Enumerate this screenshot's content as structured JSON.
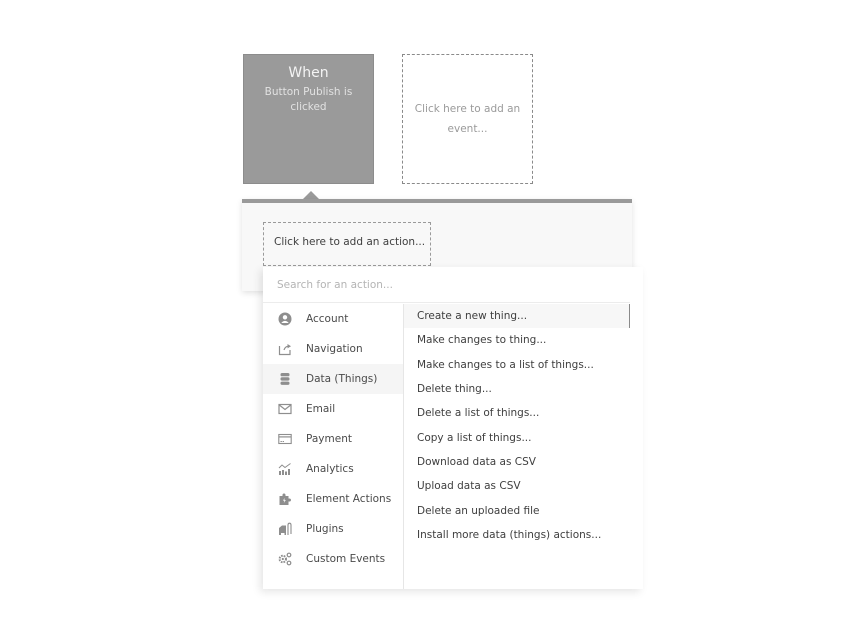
{
  "event": {
    "title": "When",
    "description": "Button Publish is clicked",
    "add_event_label": "Click here to add an event..."
  },
  "action_panel": {
    "add_action_label": "Click here to add an action..."
  },
  "dropdown": {
    "search": {
      "value": "",
      "placeholder": "Search for an action..."
    },
    "categories": [
      {
        "label": "Account",
        "icon": "account-icon"
      },
      {
        "label": "Navigation",
        "icon": "navigation-icon"
      },
      {
        "label": "Data (Things)",
        "icon": "database-icon",
        "active": true
      },
      {
        "label": "Email",
        "icon": "email-icon"
      },
      {
        "label": "Payment",
        "icon": "payment-icon"
      },
      {
        "label": "Analytics",
        "icon": "analytics-icon"
      },
      {
        "label": "Element Actions",
        "icon": "puzzle-icon"
      },
      {
        "label": "Plugins",
        "icon": "plugins-icon"
      },
      {
        "label": "Custom Events",
        "icon": "gears-icon"
      }
    ],
    "actions": [
      {
        "label": "Create a new thing...",
        "highlighted": true
      },
      {
        "label": "Make changes to thing..."
      },
      {
        "label": "Make changes to a list of things..."
      },
      {
        "label": "Delete thing..."
      },
      {
        "label": "Delete a list of things..."
      },
      {
        "label": "Copy a list of things..."
      },
      {
        "label": "Download data as CSV"
      },
      {
        "label": "Upload data as CSV"
      },
      {
        "label": "Delete an uploaded file"
      },
      {
        "label": "Install more data (things) actions..."
      }
    ]
  },
  "colors": {
    "event_card_bg": "#9a9a9a",
    "panel_bg": "#f8f8f8",
    "text": "#4a4a4a",
    "placeholder": "#b4b4b4"
  }
}
